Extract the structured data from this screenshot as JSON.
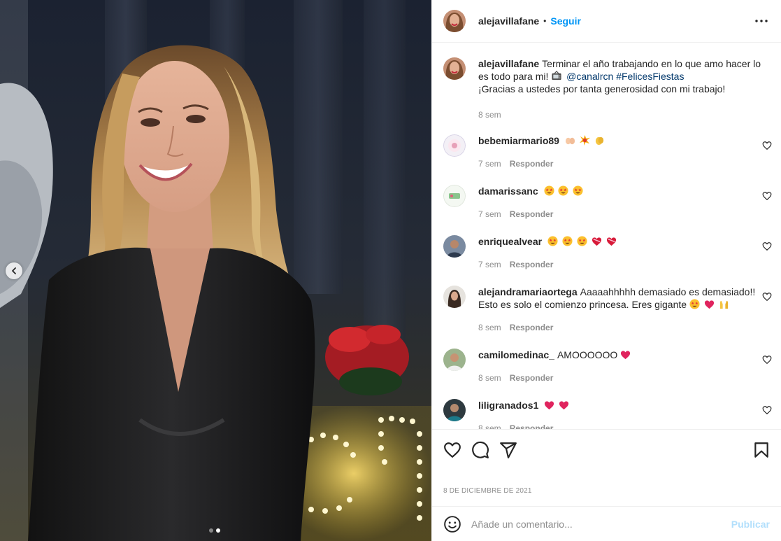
{
  "post": {
    "username": "alejavillafane",
    "separator": "•",
    "follow_label": "Seguir",
    "more_icon": "more-horizontal-icon"
  },
  "caption": {
    "username": "alejavillafane",
    "text_1": "Terminar el año trabajando en lo que amo hacer lo es todo para mi!",
    "emoji_1": "television",
    "mention": "@canalrcn",
    "hashtag": "#FelicesFiestas",
    "text_2": "¡Gracias a ustedes por tanta generosidad con mi trabajo!",
    "time": "8 sem"
  },
  "comments": [
    {
      "username": "bebemiarmario89",
      "text": "",
      "emojis": [
        "palms-up",
        "collision",
        "clapping"
      ],
      "time": "7 sem",
      "reply_label": "Responder"
    },
    {
      "username": "damarissanc",
      "text": "",
      "emojis": [
        "star-struck",
        "star-struck",
        "star-struck"
      ],
      "time": "7 sem",
      "reply_label": "Responder"
    },
    {
      "username": "enriquealvear",
      "text": "",
      "emojis": [
        "star-struck",
        "star-struck",
        "star-struck",
        "heart-with-ribbon",
        "heart-with-ribbon"
      ],
      "time": "7 sem",
      "reply_label": "Responder"
    },
    {
      "username": "alejandramariaortega",
      "text": "Aaaaahhhhh demasiado es demasiado!! Esto es solo el comienzo princesa. Eres gigante",
      "emojis": [
        "star-struck",
        "red-heart",
        "raising-hands"
      ],
      "time": "8 sem",
      "reply_label": "Responder"
    },
    {
      "username": "camilomedinac_",
      "text": "AMOOOOOO",
      "emojis": [
        "red-heart"
      ],
      "time": "8 sem",
      "reply_label": "Responder"
    },
    {
      "username": "liligranados1",
      "text": "",
      "emojis": [
        "red-heart",
        "red-heart"
      ],
      "time": "8 sem",
      "reply_label": "Responder"
    }
  ],
  "actions": {
    "like_icon": "heart-icon",
    "comment_icon": "comment-icon",
    "share_icon": "paper-plane-icon",
    "save_icon": "bookmark-icon",
    "date": "8 DE DICIEMBRE DE 2021"
  },
  "add_comment": {
    "placeholder": "Añade un comentario...",
    "publish_label": "Publicar"
  },
  "carousel": {
    "count": 2,
    "active": 1
  },
  "colors": {
    "link": "#00376b",
    "follow": "#0095f6",
    "publish_disabled": "#b2dffc",
    "muted": "#8e8e8e",
    "heart": "#ed4956"
  }
}
